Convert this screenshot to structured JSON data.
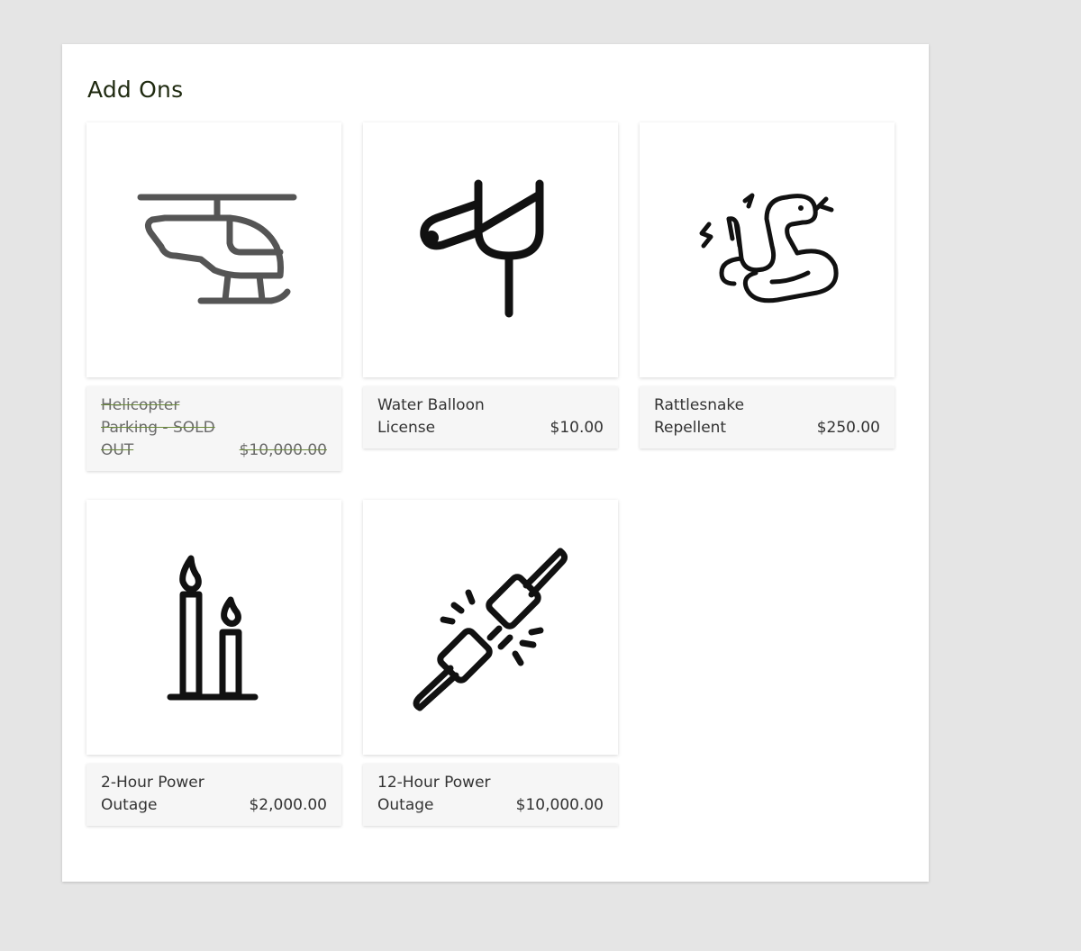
{
  "section": {
    "title": "Add Ons"
  },
  "addons": [
    {
      "name": "Helicopter Parking - SOLD OUT",
      "price": "$10,000.00",
      "icon": "helicopter-icon",
      "sold_out": true
    },
    {
      "name": "Water Balloon License",
      "price": "$10.00",
      "icon": "slingshot-icon",
      "sold_out": false
    },
    {
      "name": "Rattlesnake Repellent",
      "price": "$250.00",
      "icon": "rattlesnake-icon",
      "sold_out": false
    },
    {
      "name": "2-Hour Power Outage",
      "price": "$2,000.00",
      "icon": "candles-icon",
      "sold_out": false
    },
    {
      "name": "12-Hour Power Outage",
      "price": "$10,000.00",
      "icon": "unplugged-cable-icon",
      "sold_out": false
    }
  ],
  "colors": {
    "page_background": "#e5e5e5",
    "panel_background": "#ffffff",
    "info_background": "#f6f6f6",
    "strikethrough": "#6b8a3a",
    "title_text": "#1f2a10"
  }
}
